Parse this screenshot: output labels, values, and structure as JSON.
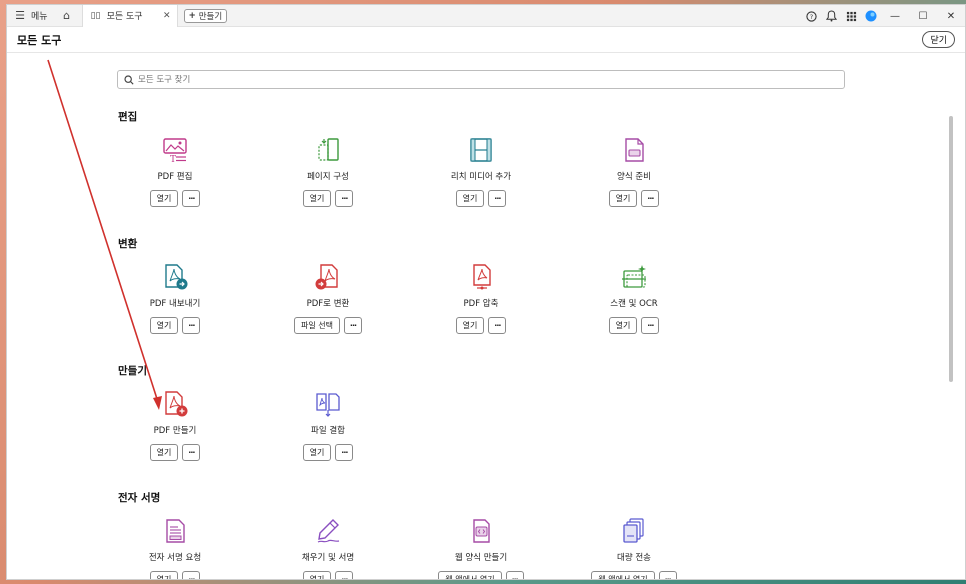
{
  "titlebar": {
    "menu_label": "메뉴",
    "tab_label": "모든 도구",
    "new_label": "만들기"
  },
  "header": {
    "title": "모든 도구",
    "close_label": "닫기"
  },
  "search": {
    "placeholder": "모든 도구 찾기"
  },
  "sections": {
    "edit": {
      "title": "편집",
      "tools": [
        {
          "name": "PDF 편집",
          "button": "열기"
        },
        {
          "name": "페이지 구성",
          "button": "열기"
        },
        {
          "name": "리치 미디어 추가",
          "button": "열기"
        },
        {
          "name": "양식 준비",
          "button": "열기"
        }
      ]
    },
    "convert": {
      "title": "변환",
      "tools": [
        {
          "name": "PDF 내보내기",
          "button": "열기"
        },
        {
          "name": "PDF로 변환",
          "button": "파일 선택"
        },
        {
          "name": "PDF 압축",
          "button": "열기"
        },
        {
          "name": "스캔 및 OCR",
          "button": "열기"
        }
      ]
    },
    "create": {
      "title": "만들기",
      "tools": [
        {
          "name": "PDF 만들기",
          "button": "열기"
        },
        {
          "name": "파일 결합",
          "button": "열기"
        }
      ]
    },
    "esign": {
      "title": "전자 서명",
      "tools": [
        {
          "name": "전자 서명 요청",
          "button": "열기"
        },
        {
          "name": "채우기 및 서명",
          "button": "열기"
        },
        {
          "name": "웹 양식 만들기",
          "button": "웹 앱에서 열기"
        },
        {
          "name": "대량 전송",
          "button": "웹 앱에서 열기"
        }
      ]
    }
  },
  "more_label": "···",
  "colors": {
    "accent_red": "#d0312d",
    "pdf_red": "#d23c3c",
    "teal": "#1f7a8c",
    "purple": "#a64ca6"
  }
}
